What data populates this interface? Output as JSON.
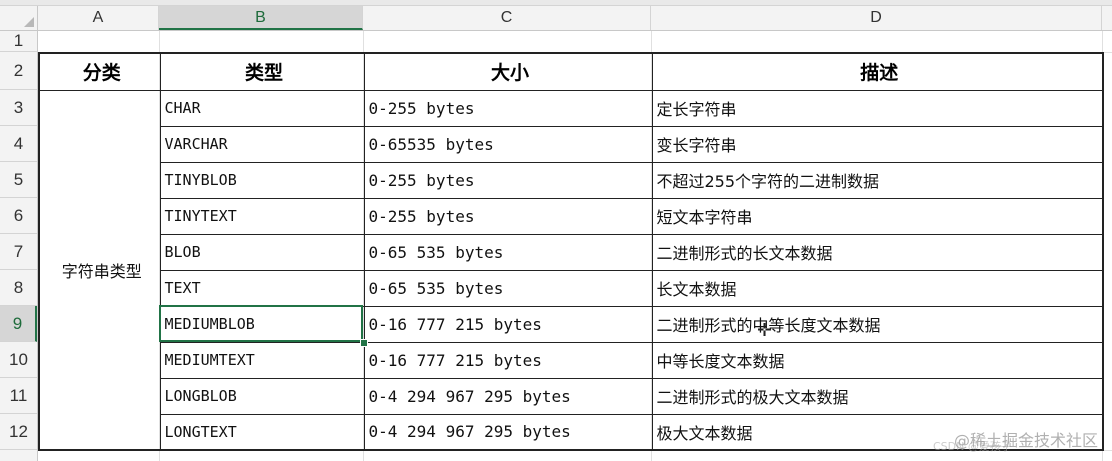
{
  "column_headers": [
    "A",
    "B",
    "C",
    "D"
  ],
  "row_numbers": [
    "1",
    "2",
    "3",
    "4",
    "5",
    "6",
    "7",
    "8",
    "9",
    "10",
    "11",
    "12"
  ],
  "selected_column": "B",
  "selected_row": "9",
  "table": {
    "headers": [
      "分类",
      "类型",
      "大小",
      "描述"
    ],
    "category": "字符串类型",
    "rows": [
      {
        "type": "CHAR",
        "size": "0-255 bytes",
        "desc": "定长字符串"
      },
      {
        "type": "VARCHAR",
        "size": "0-65535 bytes",
        "desc": "变长字符串"
      },
      {
        "type": "TINYBLOB",
        "size": "0-255 bytes",
        "desc": "不超过255个字符的二进制数据"
      },
      {
        "type": "TINYTEXT",
        "size": "0-255 bytes",
        "desc": "短文本字符串"
      },
      {
        "type": "BLOB",
        "size": "0-65 535 bytes",
        "desc": "二进制形式的长文本数据"
      },
      {
        "type": "TEXT",
        "size": "0-65 535 bytes",
        "desc": "长文本数据"
      },
      {
        "type": "MEDIUMBLOB",
        "size": "0-16 777 215 bytes",
        "desc": "二进制形式的中等长度文本数据"
      },
      {
        "type": "MEDIUMTEXT",
        "size": "0-16 777 215 bytes",
        "desc": "中等长度文本数据"
      },
      {
        "type": "LONGBLOB",
        "size": "0-4 294 967 295 bytes",
        "desc": "二进制形式的极大文本数据"
      },
      {
        "type": "LONGTEXT",
        "size": "0-4 294 967 295 bytes",
        "desc": "极大文本数据"
      }
    ]
  },
  "watermark": "@稀土掘金技术社区",
  "watermark_faint": "CSDN @爱孩子"
}
